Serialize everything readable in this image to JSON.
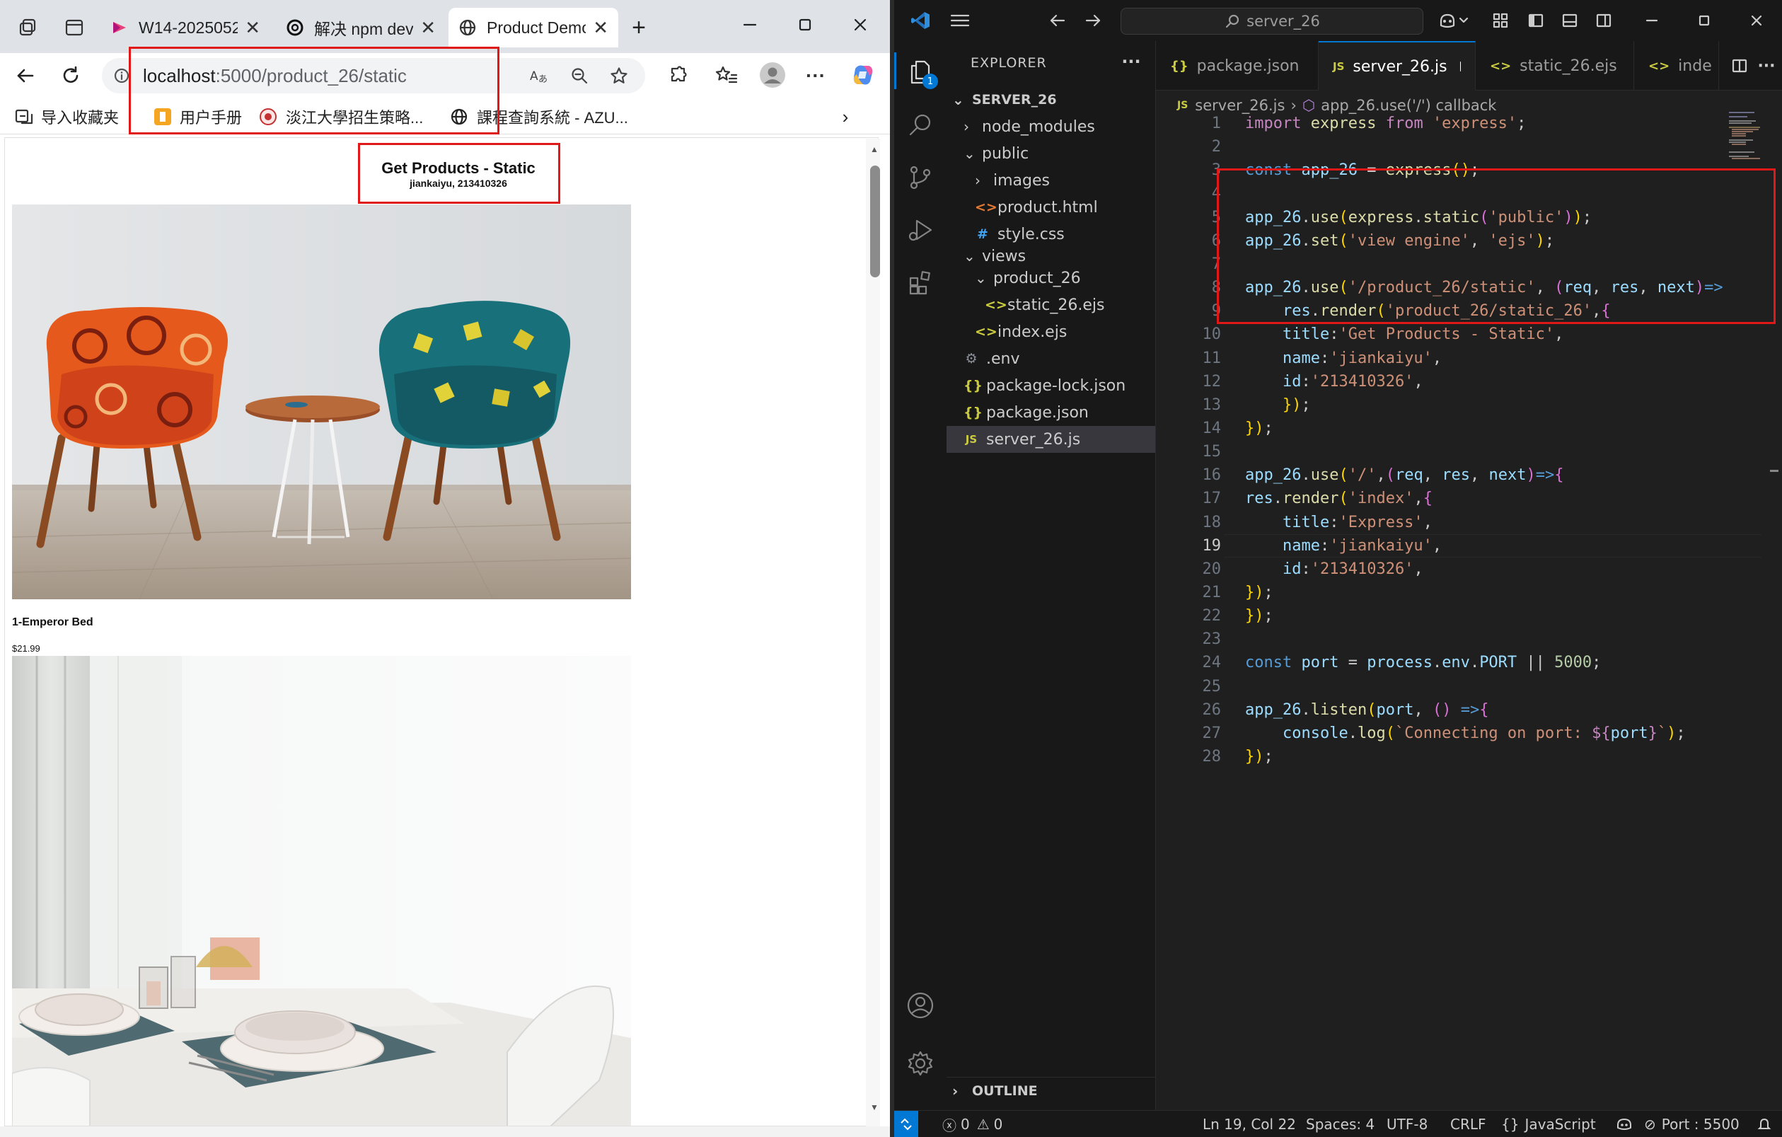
{
  "browser": {
    "tabs": [
      {
        "title": "W14-2025052",
        "favicon": "app-icon"
      },
      {
        "title": "解决 npm dev",
        "favicon": "openai-icon"
      },
      {
        "title": "Product Demo",
        "favicon": "globe-icon"
      }
    ],
    "url": {
      "host": "localhost",
      "path": ":5000/product_26/static"
    },
    "favorites": [
      {
        "label": "导入收藏夹"
      },
      {
        "label": "用户手册"
      },
      {
        "label": "淡江大學招生策略..."
      },
      {
        "label": "課程查詢系統 - AZU..."
      }
    ],
    "page": {
      "title": "Get Products - Static",
      "subtitle": "jiankaiyu, 213410326",
      "product": {
        "name": "1-Emperor Bed",
        "price": "$21.99"
      }
    }
  },
  "vscode": {
    "search": "server_26",
    "explorer": {
      "header": "EXPLORER",
      "root": "SERVER_26",
      "outline": "OUTLINE",
      "items": [
        {
          "label": "node_modules",
          "type": "folder",
          "open": false
        },
        {
          "label": "public",
          "type": "folder",
          "open": true
        },
        {
          "label": "images",
          "type": "folder",
          "open": false
        },
        {
          "label": "product.html",
          "type": "html"
        },
        {
          "label": "style.css",
          "type": "css"
        },
        {
          "label": "views",
          "type": "folder",
          "open": true
        },
        {
          "label": "product_26",
          "type": "folder",
          "open": true
        },
        {
          "label": "static_26.ejs",
          "type": "ejs"
        },
        {
          "label": "index.ejs",
          "type": "ejs"
        },
        {
          "label": ".env",
          "type": "env"
        },
        {
          "label": "package-lock.json",
          "type": "json"
        },
        {
          "label": "package.json",
          "type": "json"
        },
        {
          "label": "server_26.js",
          "type": "js",
          "selected": true
        }
      ]
    },
    "tabs": [
      {
        "label": "package.json",
        "icon": "{}"
      },
      {
        "label": "server_26.js",
        "icon": "JS",
        "active": true,
        "dirty": true
      },
      {
        "label": "static_26.ejs",
        "icon": "<>"
      },
      {
        "label": "inde",
        "icon": "<>"
      }
    ],
    "breadcrumb": {
      "file": "server_26.js",
      "symbol": "app_26.use('/') callback"
    },
    "code_lines": [
      "import express from 'express';",
      "",
      "const app_26 = express();",
      "",
      "app_26.use(express.static('public'));",
      "app_26.set('view engine', 'ejs');",
      "",
      "app_26.use('/product_26/static', (req, res, next)=>",
      "    res.render('product_26/static_26',{",
      "    title:'Get Products - Static',",
      "    name:'jiankaiyu',",
      "    id:'213410326',",
      "    });",
      "});",
      "",
      "app_26.use('/',(req, res, next)=>{",
      "res.render('index',{",
      "    title:'Express',",
      "    name:'jiankaiyu',",
      "    id:'213410326',",
      "});",
      "});",
      "",
      "const port = process.env.PORT || 5000;",
      "",
      "app_26.listen(port, () =>{",
      "    console.log(`Connecting on port: ${port}`);",
      "});"
    ],
    "current_line": 19,
    "status": {
      "errors": "0",
      "warnings": "0",
      "position": "Ln 19, Col 22",
      "spaces": "Spaces: 4",
      "encoding": "UTF-8",
      "eol": "CRLF",
      "language": "JavaScript",
      "port": "Port : 5500",
      "badge": "1"
    }
  }
}
